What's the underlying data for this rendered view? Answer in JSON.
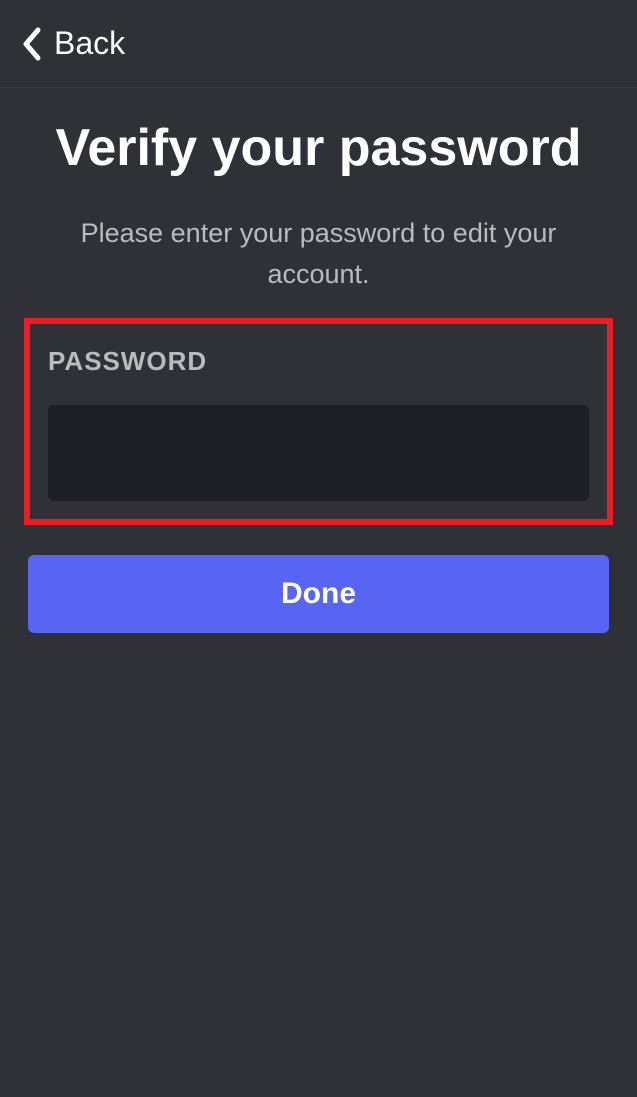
{
  "header": {
    "back_label": "Back"
  },
  "main": {
    "title": "Verify your password",
    "subtitle": "Please enter your password to edit your account.",
    "password_label": "PASSWORD",
    "password_value": "",
    "done_label": "Done"
  },
  "colors": {
    "background": "#2f3136",
    "input_background": "#1e1f24",
    "primary_button": "#5865f2",
    "text_primary": "#ffffff",
    "text_secondary": "#b9bbbe",
    "highlight_border": "#ed1c24"
  }
}
